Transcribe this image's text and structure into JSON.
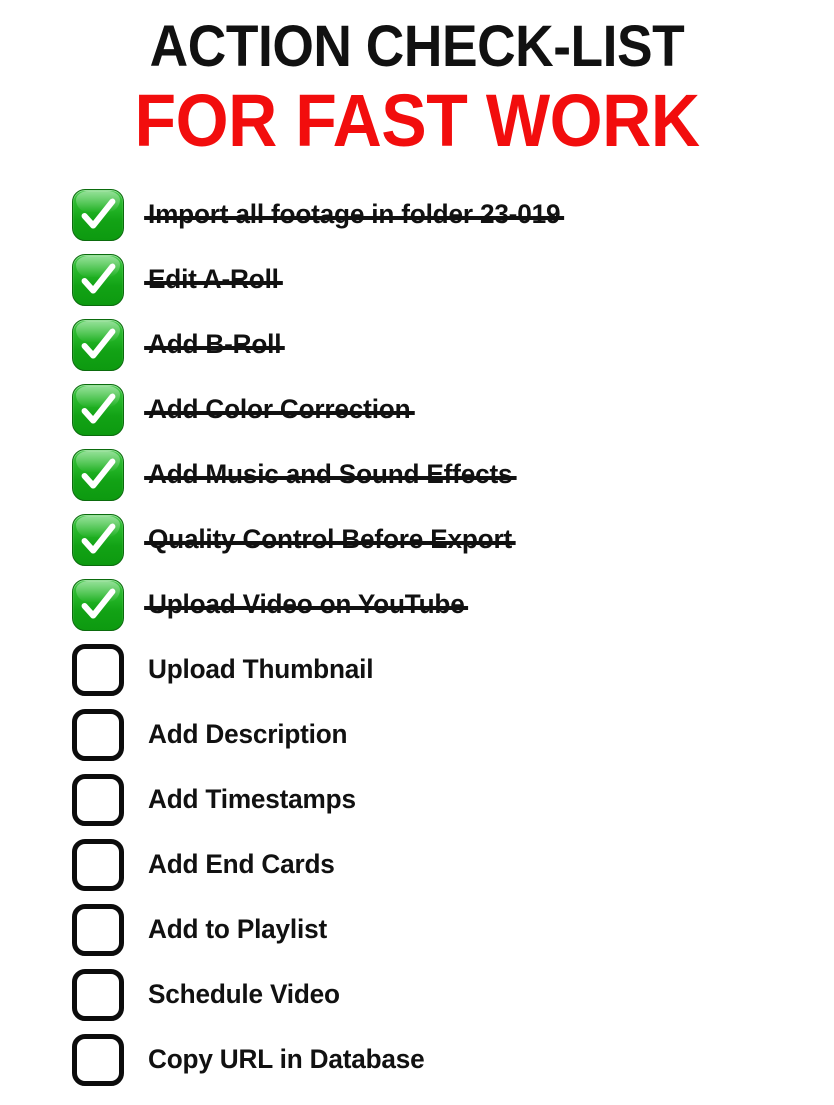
{
  "title": {
    "line1": "ACTION CHECK-LIST",
    "line2": "FOR FAST WORK",
    "line1_color": "#111111",
    "line2_color": "#F20D0D"
  },
  "theme": {
    "checked_green": "#12A215",
    "checked_green_light": "#3FC845",
    "checkbox_border": "#0C0C0C",
    "text_color": "#111111",
    "background": "#FFFFFF"
  },
  "checklist": {
    "checked_count": 7,
    "total_count": 14,
    "items": [
      {
        "label": "Import all footage in folder 23-019",
        "checked": true,
        "icon": "checked-checkbox-icon"
      },
      {
        "label": "Edit A-Roll",
        "checked": true,
        "icon": "checked-checkbox-icon"
      },
      {
        "label": "Add B-Roll",
        "checked": true,
        "icon": "checked-checkbox-icon"
      },
      {
        "label": "Add Color Correction",
        "checked": true,
        "icon": "checked-checkbox-icon"
      },
      {
        "label": "Add Music and Sound Effects",
        "checked": true,
        "icon": "checked-checkbox-icon"
      },
      {
        "label": "Quality Control Before Export",
        "checked": true,
        "icon": "checked-checkbox-icon"
      },
      {
        "label": "Upload Video on YouTube",
        "checked": true,
        "icon": "checked-checkbox-icon"
      },
      {
        "label": "Upload Thumbnail",
        "checked": false,
        "icon": "empty-checkbox-icon"
      },
      {
        "label": "Add Description",
        "checked": false,
        "icon": "empty-checkbox-icon"
      },
      {
        "label": "Add Timestamps",
        "checked": false,
        "icon": "empty-checkbox-icon"
      },
      {
        "label": "Add End Cards",
        "checked": false,
        "icon": "empty-checkbox-icon"
      },
      {
        "label": "Add to Playlist",
        "checked": false,
        "icon": "empty-checkbox-icon"
      },
      {
        "label": "Schedule Video",
        "checked": false,
        "icon": "empty-checkbox-icon"
      },
      {
        "label": "Copy URL in Database",
        "checked": false,
        "icon": "empty-checkbox-icon"
      }
    ]
  }
}
